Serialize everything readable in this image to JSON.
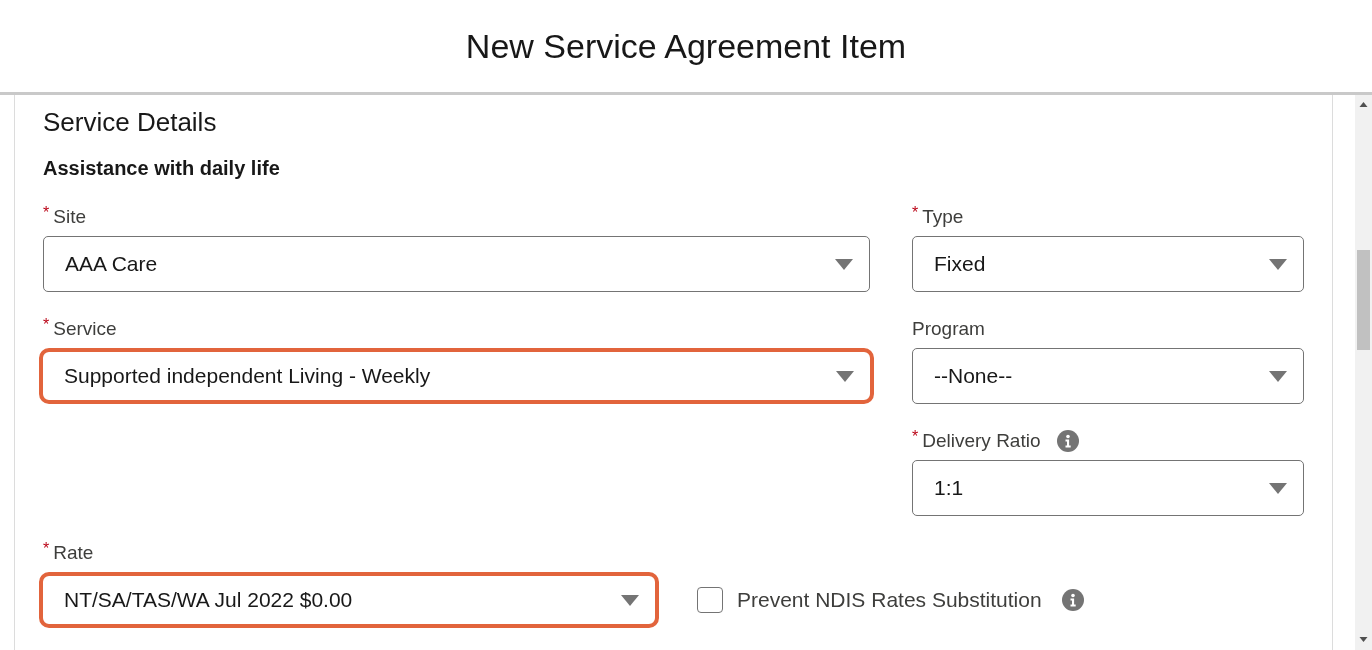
{
  "title": "New Service Agreement Item",
  "section": {
    "heading": "Service Details",
    "subheading": "Assistance with daily life",
    "rows": [
      {
        "left": {
          "kind": "select",
          "required_mark": "*",
          "label": "Site",
          "value": "AAA Care",
          "highlighted": false
        },
        "right": {
          "kind": "select",
          "required_mark": "*",
          "label": "Type",
          "value": "Fixed",
          "highlighted": false
        }
      },
      {
        "left": {
          "kind": "select",
          "required_mark": "*",
          "label": "Service",
          "value": "Supported independent Living - Weekly",
          "highlighted": true
        },
        "right": {
          "kind": "select",
          "label": "Program",
          "value": "--None--",
          "highlighted": false
        }
      },
      {
        "right": {
          "kind": "select",
          "required_mark": "*",
          "label": "Delivery Ratio",
          "info": true,
          "value": "1:1",
          "highlighted": false
        }
      },
      {
        "left": {
          "kind": "select",
          "required_mark": "*",
          "label": "Rate",
          "value": "NT/SA/TAS/WA Jul 2022 $0.00",
          "highlighted": true
        },
        "right": {
          "kind": "checkbox",
          "label": "Prevent NDIS Rates Substitution",
          "checked": false,
          "info": true
        }
      }
    ]
  }
}
